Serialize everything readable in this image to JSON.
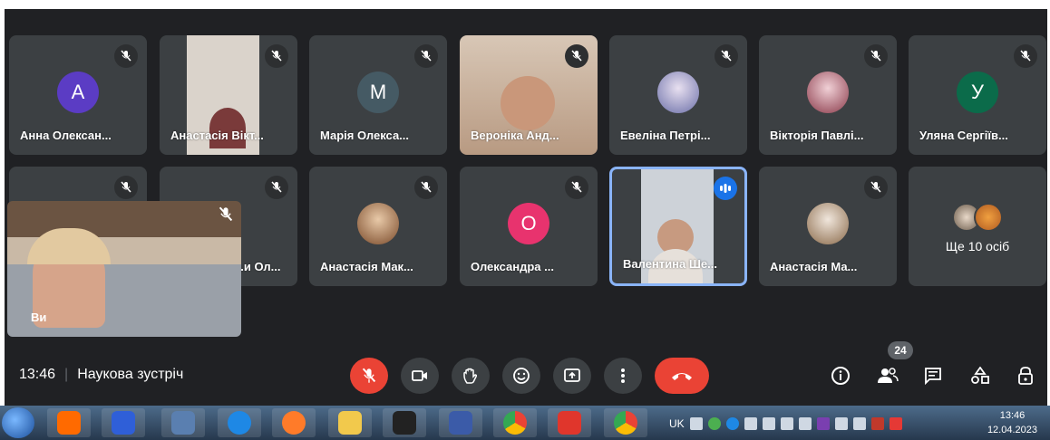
{
  "meeting": {
    "time": "13:46",
    "title": "Наукова зустріч"
  },
  "participants_row1": [
    {
      "name": "Анна Олексан...",
      "type": "letter",
      "letter": "A",
      "color": "#5b3cc4"
    },
    {
      "name": "Анастасія Вікт...",
      "type": "video"
    },
    {
      "name": "Марія Олекса...",
      "type": "letter",
      "letter": "M",
      "color": "#455a64"
    },
    {
      "name": "Вероніка Анд...",
      "type": "video"
    },
    {
      "name": "Евеліна Петрі...",
      "type": "photo"
    },
    {
      "name": "Вікторія Павлі...",
      "type": "photo"
    },
    {
      "name": "Уляна Сергіїв...",
      "type": "letter",
      "letter": "У",
      "color": "#0b6b4a"
    }
  ],
  "participants_row2": [
    {
      "name": "",
      "type": "hidden"
    },
    {
      "name": "...и Ол...",
      "type": "hidden"
    },
    {
      "name": "Анастасія Мак...",
      "type": "photo"
    },
    {
      "name": "Олександра ...",
      "type": "letter",
      "letter": "O",
      "color": "#e8336e"
    },
    {
      "name": "Валентина Ше...",
      "type": "video",
      "speaking": true
    },
    {
      "name": "Анастасія Ма...",
      "type": "photo"
    }
  ],
  "more_tile": {
    "label": "Ще 10 осіб"
  },
  "self_view": {
    "name": "Ви"
  },
  "controls": {
    "mic": "mic-off-icon",
    "camera": "camera-icon",
    "hand": "raise-hand-icon",
    "emoji": "emoji-icon",
    "present": "present-icon",
    "more": "more-options-icon",
    "hangup": "hang-up-icon"
  },
  "right_controls": {
    "people_count": "24"
  },
  "taskbar": {
    "lang": "UK",
    "clock_time": "13:46",
    "clock_date": "12.04.2023"
  },
  "colors": {
    "background": "#202124",
    "tile": "#3c4043",
    "accent_red": "#ea4335",
    "active_border": "#8ab4f8"
  }
}
